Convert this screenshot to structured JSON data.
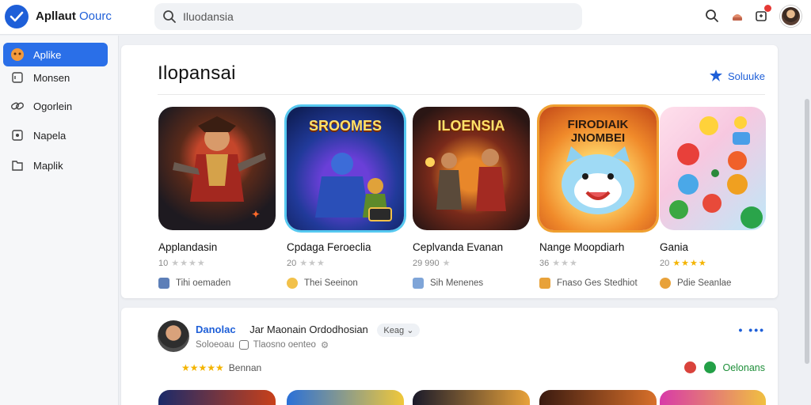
{
  "app": {
    "brand_primary": "Apllaut",
    "brand_secondary": "Oourc"
  },
  "search": {
    "value": "Iluodansia",
    "placeholder": "Iluodansia"
  },
  "colors": {
    "accent": "#1e5fd8",
    "active": "#2a6fe8",
    "star": "#f4b400"
  },
  "sidebar": {
    "items": [
      {
        "label": "Aplike",
        "icon": "app-icon",
        "active": true
      },
      {
        "label": "Monsen",
        "icon": "box-icon",
        "active": false
      },
      {
        "label": "Ogorlein",
        "icon": "link-icon",
        "active": false
      },
      {
        "label": "Napela",
        "icon": "square-icon",
        "active": false
      },
      {
        "label": "Maplik",
        "icon": "folder-icon",
        "active": false
      }
    ]
  },
  "section": {
    "title": "Ilopansai",
    "see_more": "Soluuke",
    "apps": [
      {
        "thumb_text": "",
        "name": "Applandasin",
        "rating": "10",
        "stars": "★★★★",
        "meta": "Tihi oemaden"
      },
      {
        "thumb_text": "SROOMES",
        "name": "Cpdaga Feroeclia",
        "rating": "20",
        "stars": "★★★",
        "meta": "Thei Seeinon"
      },
      {
        "thumb_text": "ILOENSIA",
        "name": "Ceplvanda Evanan",
        "rating": "29 990",
        "stars": "★",
        "meta": "Sih Menenes"
      },
      {
        "thumb_text": "FIRODIAIK JNOMBEI",
        "name": "Nange Moopdiarh",
        "rating": "36",
        "stars": "★★★",
        "meta": "Fnaso Ges Stedhiot"
      },
      {
        "thumb_text": "",
        "name": "Gania",
        "rating": "20",
        "stars": "★★★★",
        "meta": "Pdie Seanlae"
      }
    ]
  },
  "review": {
    "user": "Danolac",
    "title": "Jar Maonain Ordodhosian",
    "tag": "Keag",
    "sub1": "Soloeoau",
    "sub2": "Tlaosno oenteo",
    "stars": "★★★★★",
    "stars_label": "Bennan",
    "action": "Oelonans",
    "more": "• •••"
  }
}
